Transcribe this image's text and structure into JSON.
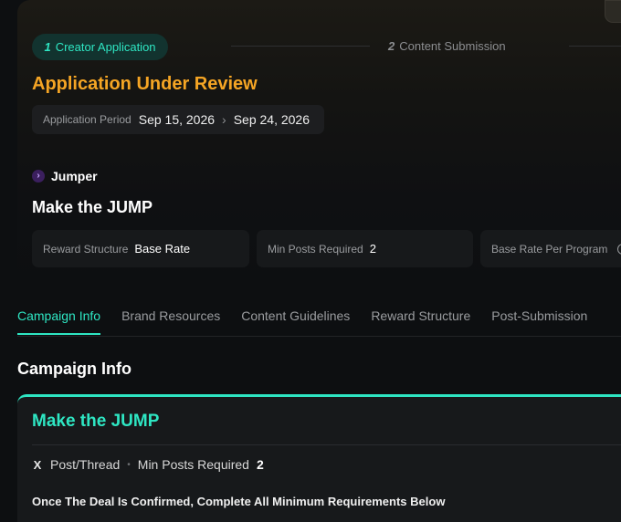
{
  "steps": [
    {
      "num": "1",
      "label": "Creator Application"
    },
    {
      "num": "2",
      "label": "Content Submission"
    }
  ],
  "status": "Application Under Review",
  "application_period": {
    "label": "Application Period",
    "start": "Sep 15, 2026",
    "end": "Sep 24, 2026"
  },
  "brand": {
    "name": "Jumper"
  },
  "campaign": {
    "title": "Make the JUMP"
  },
  "stats": [
    {
      "label": "Reward Structure",
      "value": "Base Rate"
    },
    {
      "label": "Min Posts Required",
      "value": "2"
    },
    {
      "label": "Base Rate Per Program",
      "value": ""
    }
  ],
  "tabs": [
    "Campaign Info",
    "Brand Resources",
    "Content Guidelines",
    "Reward Structure",
    "Post-Submission"
  ],
  "active_tab": "Campaign Info",
  "section_title": "Campaign Info",
  "card": {
    "title": "Make the JUMP",
    "platform": "Post/Thread",
    "min_posts_label": "Min Posts Required",
    "min_posts_value": "2",
    "requirements_heading": "Once The Deal Is Confirmed, Complete All Minimum Requirements Below"
  },
  "colors": {
    "accent": "#2ee6c3",
    "status": "#f5a524"
  },
  "icons": {
    "brand_logo": "chevron-right-icon",
    "period_arrow": "chevron-right-icon",
    "info": "info-icon",
    "platform": "x-logo-icon"
  }
}
